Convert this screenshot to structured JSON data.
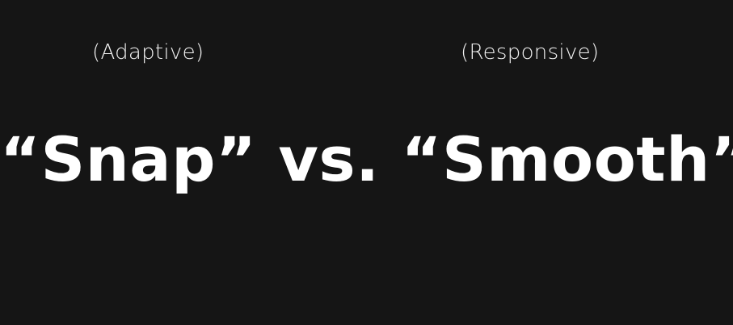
{
  "labels": {
    "left": "(Adaptive)",
    "right": "(Responsive)"
  },
  "headline": {
    "text": "“Snap” vs. “Smooth”"
  },
  "colors": {
    "background": "#151515",
    "text": "#ffffff"
  }
}
